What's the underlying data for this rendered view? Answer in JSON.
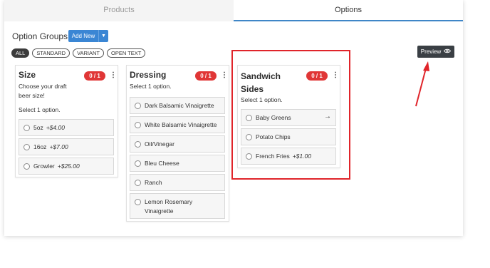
{
  "tabs": {
    "products": "Products",
    "options": "Options"
  },
  "header": {
    "title": "Option Groups",
    "add_new": "Add New",
    "preview": "Preview"
  },
  "filters": [
    "ALL",
    "STANDARD",
    "VARIANT",
    "OPEN TEXT"
  ],
  "groups": [
    {
      "title": "Size",
      "badge": "0 / 1",
      "description": "Choose your draft beer size!",
      "instruction": "Select 1 option.",
      "options": [
        {
          "label": "5oz",
          "price": "+$4.00"
        },
        {
          "label": "16oz",
          "price": "+$7.00"
        },
        {
          "label": "Growler",
          "price": "+$25.00"
        }
      ]
    },
    {
      "title": "Dressing",
      "badge": "0 / 1",
      "instruction": "Select 1 option.",
      "options": [
        {
          "label": "Dark Balsamic Vinaigrette"
        },
        {
          "label": "White Balsamic Vinaigrette"
        },
        {
          "label": "Oil/Vinegar"
        },
        {
          "label": "Bleu Cheese"
        },
        {
          "label": "Ranch"
        },
        {
          "label": "Lemon Rosemary Vinaigrette"
        }
      ]
    },
    {
      "title": "Sandwich Sides",
      "badge": "0 / 1",
      "instruction": "Select 1 option.",
      "options": [
        {
          "label": "Baby Greens"
        },
        {
          "label": "Potato Chips"
        },
        {
          "label": "French Fries",
          "price": "+$1.00"
        }
      ]
    }
  ],
  "colors": {
    "accent": "#3a86d4",
    "badge": "#e03636",
    "highlight": "#e0242a",
    "preview_button": "#3a3f44"
  },
  "icons": {
    "preview": "eye-icon",
    "menu": "kebab-menu-icon",
    "dropdown": "caret-down-icon",
    "arrow": "arrow-right-icon",
    "annotation": "red-pointer-arrow"
  }
}
